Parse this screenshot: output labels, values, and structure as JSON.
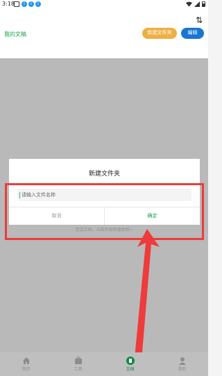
{
  "status_bar": {
    "time": "3:18"
  },
  "header": {
    "title": "我的文稿",
    "new_folder_label": "新建文件夹",
    "edit_label": "编辑"
  },
  "dialog": {
    "title": "新建文件夹",
    "input_placeholder": "请输入文件名称",
    "cancel_label": "取消",
    "confirm_label": "确定"
  },
  "empty_hint": "还没文档，点击开始快速体验~",
  "tabs": [
    {
      "label": "首页",
      "icon": "home-icon"
    },
    {
      "label": "工具",
      "icon": "briefcase-icon"
    },
    {
      "label": "文档",
      "icon": "document-icon",
      "active": true
    },
    {
      "label": "我的",
      "icon": "profile-icon"
    }
  ],
  "colors": {
    "accent": "#17a34a",
    "highlight": "#ee3b3b",
    "new_folder_button": "#ecb044",
    "edit_button": "#1976d2"
  }
}
